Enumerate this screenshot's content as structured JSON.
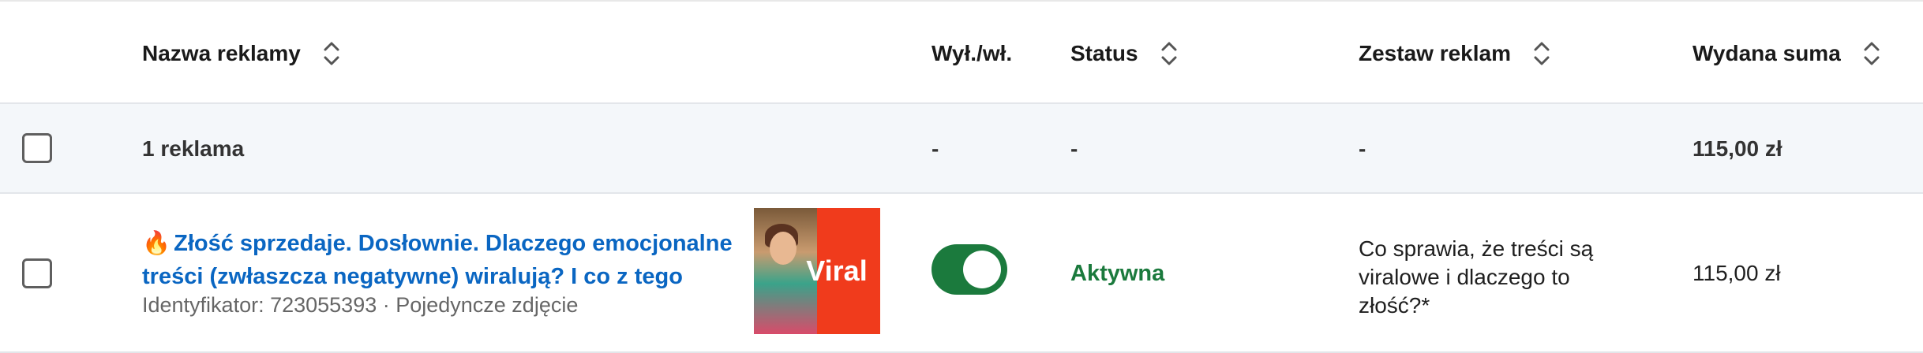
{
  "header": {
    "name": "Nazwa reklamy",
    "toggle": "Wył./wł.",
    "status": "Status",
    "adset": "Zestaw reklam",
    "spent": "Wydana suma"
  },
  "summary": {
    "count": "1 reklama",
    "toggle": "-",
    "status": "-",
    "adset": "-",
    "spent": "115,00 zł"
  },
  "ad": {
    "flame": "🔥",
    "title": "Złość sprzedaje. Dosłownie. Dlaczego emocjonalne treści (zwłaszcza negatywne) wiralują? I co z tego",
    "meta": "Identyfikator: 723055393 · Pojedyncze zdjęcie",
    "thumbnail_text": "Viral",
    "toggle_on": true,
    "status": "Aktywna",
    "adset": "Co sprawia, że treści są viralowe i dlaczego to złość?*",
    "spent": "115,00 zł"
  },
  "colors": {
    "link": "#0a66c2",
    "active": "#1b7a3d",
    "summary_bg": "#f4f7fa",
    "thumb_red": "#f03b1c"
  },
  "icons": {
    "sort": "sort-icon",
    "checkbox": "checkbox"
  }
}
